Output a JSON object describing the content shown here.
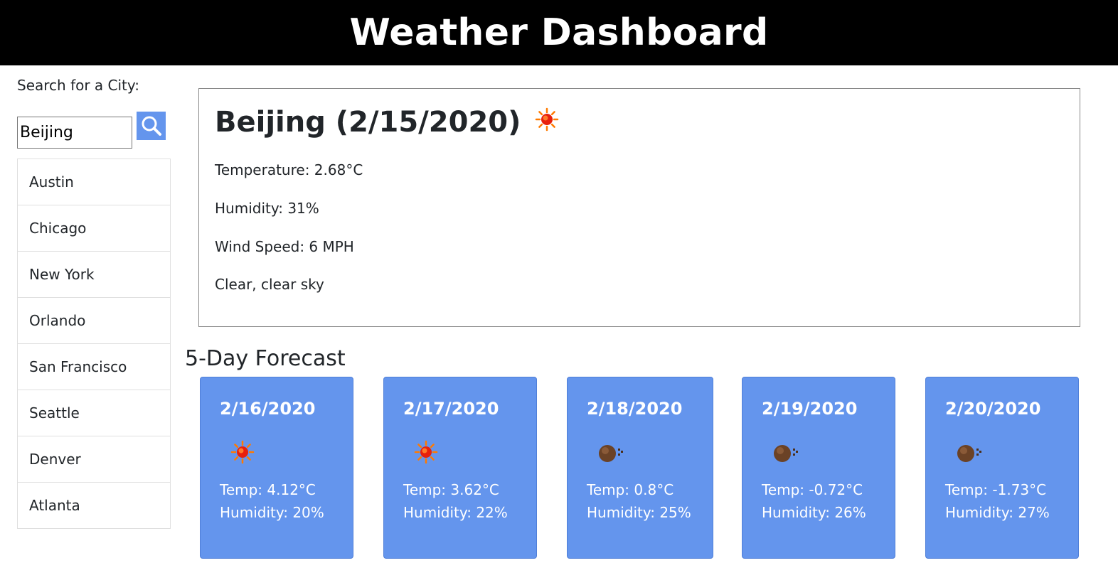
{
  "header": {
    "title": "Weather Dashboard"
  },
  "sidebar": {
    "search_label": "Search for a City:",
    "search_value": "Beijing",
    "search_icon": "search-icon",
    "cities": [
      "Austin",
      "Chicago",
      "New York",
      "Orlando",
      "San Francisco",
      "Seattle",
      "Denver",
      "Atlanta"
    ]
  },
  "current": {
    "title": "Beijing (2/15/2020)",
    "icon": "sun-icon",
    "temperature": "Temperature: 2.68°C",
    "humidity": "Humidity: 31%",
    "wind": "Wind Speed: 6 MPH",
    "description": "Clear, clear sky"
  },
  "forecast": {
    "heading": "5-Day Forecast",
    "days": [
      {
        "date": "2/16/2020",
        "icon": "sun-icon",
        "temp": "Temp: 4.12°C",
        "humidity": "Humidity: 20%"
      },
      {
        "date": "2/17/2020",
        "icon": "sun-icon",
        "temp": "Temp: 3.62°C",
        "humidity": "Humidity: 22%"
      },
      {
        "date": "2/18/2020",
        "icon": "cloud-icon",
        "temp": "Temp: 0.8°C",
        "humidity": "Humidity: 25%"
      },
      {
        "date": "2/19/2020",
        "icon": "cloud-icon",
        "temp": "Temp: -0.72°C",
        "humidity": "Humidity: 26%"
      },
      {
        "date": "2/20/2020",
        "icon": "cloud-icon",
        "temp": "Temp: -1.73°C",
        "humidity": "Humidity: 27%"
      }
    ]
  },
  "colors": {
    "header_bg": "#000000",
    "accent": "#6495ed"
  }
}
